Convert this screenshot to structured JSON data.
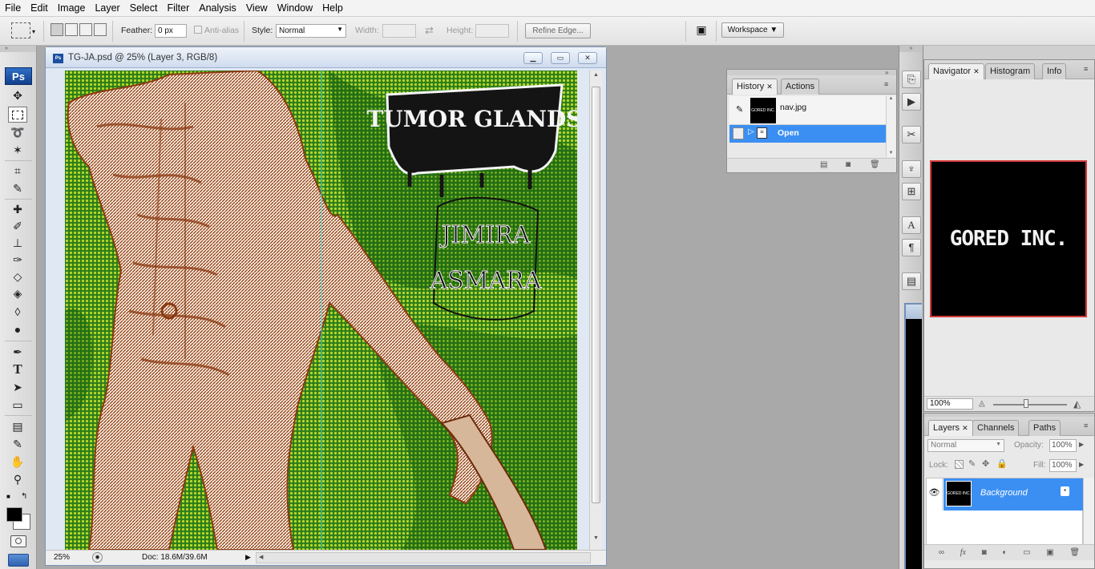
{
  "menu": [
    "File",
    "Edit",
    "Image",
    "Layer",
    "Select",
    "Filter",
    "Analysis",
    "View",
    "Window",
    "Help"
  ],
  "options": {
    "feather_label": "Feather:",
    "feather_value": "0 px",
    "antialias_label": "Anti-alias",
    "style_label": "Style:",
    "style_value": "Normal",
    "width_label": "Width:",
    "height_label": "Height:",
    "refine_label": "Refine Edge...",
    "workspace_label": "Workspace"
  },
  "tools_logo": "Ps",
  "document": {
    "title": "TG-JA.psd @ 25% (Layer 3, RGB/8)",
    "zoom": "25%",
    "doc_size": "Doc: 18.6M/39.6M",
    "canvas_text": {
      "band": "TUMOR GLANDS",
      "album_line1": "JIMIRA",
      "album_line2": "ASMARA"
    }
  },
  "history": {
    "tabs": [
      "History",
      "Actions"
    ],
    "snapshot_name": "nav.jpg",
    "snapshot_thumb_text": "GORED INC.",
    "step": "Open"
  },
  "navigator": {
    "tabs": [
      "Navigator",
      "Histogram",
      "Info"
    ],
    "preview_text": "GORED INC.",
    "zoom": "100%"
  },
  "layers": {
    "tabs": [
      "Layers",
      "Channels",
      "Paths"
    ],
    "blend_mode": "Normal",
    "opacity_label": "Opacity:",
    "opacity": "100%",
    "lock_label": "Lock:",
    "fill_label": "Fill:",
    "fill": "100%",
    "layer_name": "Background",
    "layer_thumb_text": "GORED INC.",
    "footer_icons": [
      "link-icon",
      "fx-icon",
      "mask-icon",
      "adjustment-icon",
      "group-icon",
      "new-layer-icon",
      "trash-icon"
    ]
  },
  "colors": {
    "selection": "#3b8ff3",
    "ps_logo": "#1b4fa0",
    "canvas_green": "#2f7f1c",
    "body_brown": "#8b3a12"
  }
}
